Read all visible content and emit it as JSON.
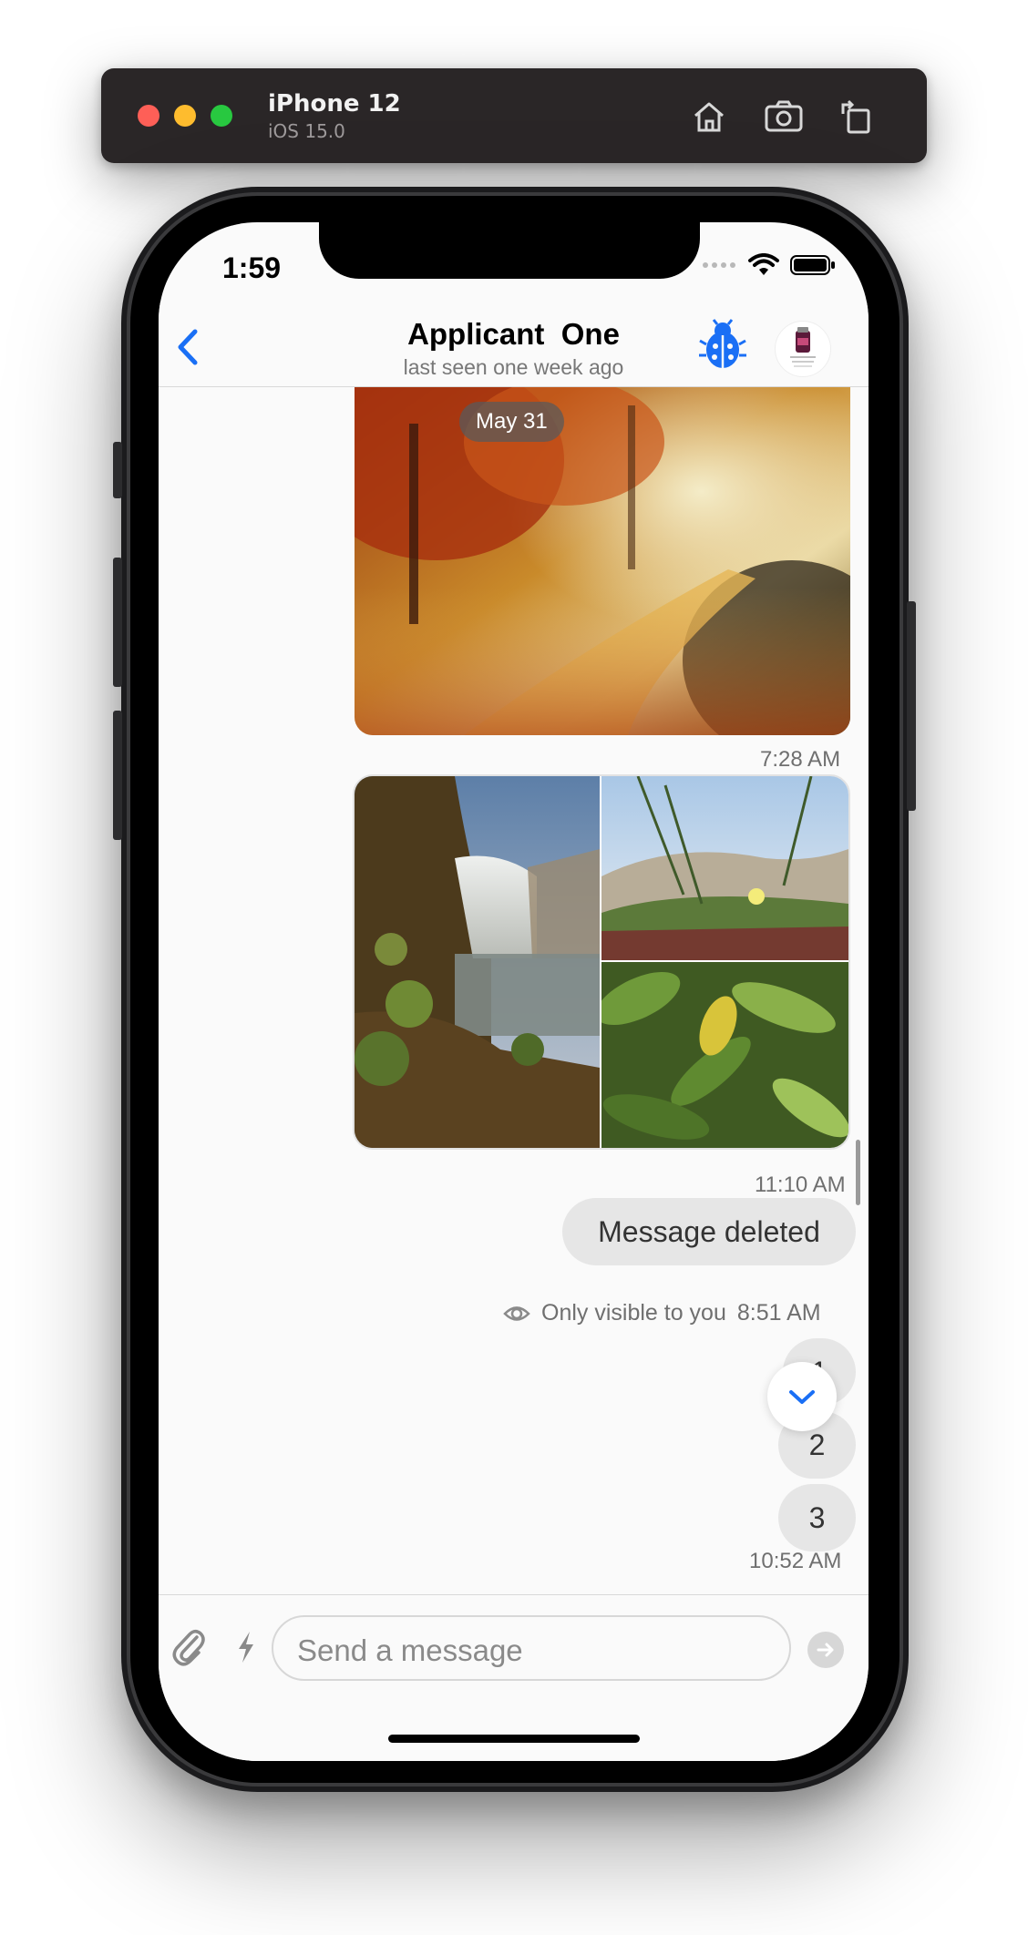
{
  "simulator": {
    "device_name": "iPhone 12",
    "os_version": "iOS 15.0",
    "buttons": [
      "home-icon",
      "screenshot-icon",
      "rotate-icon"
    ]
  },
  "status_bar": {
    "time": "1:59"
  },
  "header": {
    "title": "Applicant  One",
    "subtitle": "last seen one week ago",
    "accent_color": "#1a6ff5"
  },
  "chat": {
    "date_separator": "May 31",
    "messages": [
      {
        "type": "image",
        "time": "7:28 AM"
      },
      {
        "type": "image-gallery",
        "count": 3,
        "time": "11:10 AM"
      },
      {
        "type": "deleted",
        "text": "Message deleted",
        "visibility_note": "Only visible to you",
        "time": "8:51 AM"
      },
      {
        "type": "text",
        "text": "1"
      },
      {
        "type": "text",
        "text": "2"
      },
      {
        "type": "text",
        "text": "3",
        "time": "10:52 AM"
      }
    ]
  },
  "composer": {
    "placeholder": "Send a message"
  }
}
